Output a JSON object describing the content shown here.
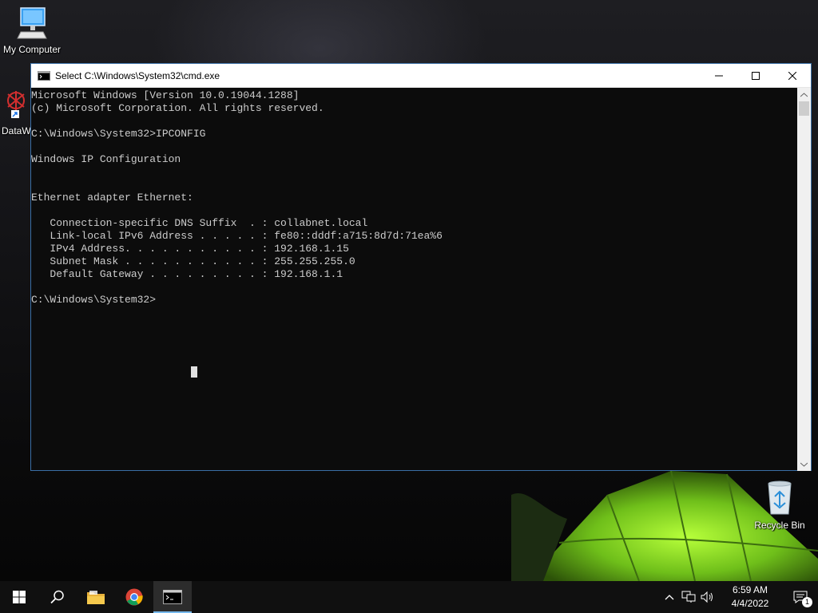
{
  "desktop": {
    "icons": [
      {
        "label": "My Computer"
      },
      {
        "label": "DataW"
      },
      {
        "label": "Recycle Bin"
      }
    ]
  },
  "cmd_window": {
    "title": "Select C:\\Windows\\System32\\cmd.exe",
    "output": "Microsoft Windows [Version 10.0.19044.1288]\n(c) Microsoft Corporation. All rights reserved.\n\nC:\\Windows\\System32>IPCONFIG\n\nWindows IP Configuration\n\n\nEthernet adapter Ethernet:\n\n   Connection-specific DNS Suffix  . : collabnet.local\n   Link-local IPv6 Address . . . . . : fe80::dddf:a715:8d7d:71ea%6\n   IPv4 Address. . . . . . . . . . . : 192.168.1.15\n   Subnet Mask . . . . . . . . . . . : 255.255.255.0\n   Default Gateway . . . . . . . . . : 192.168.1.1\n\nC:\\Windows\\System32>"
  },
  "taskbar": {
    "pinned": [
      "start-icon",
      "search-icon",
      "file-explorer-icon",
      "chrome-icon",
      "cmd-icon"
    ],
    "clock_time": "6:59 AM",
    "clock_date": "4/4/2022",
    "notification_count": "1"
  },
  "colors": {
    "console_bg": "#0c0c0c",
    "console_fg": "#cccccc",
    "taskbar_bg": "#101010",
    "accent": "#76b9ed"
  }
}
